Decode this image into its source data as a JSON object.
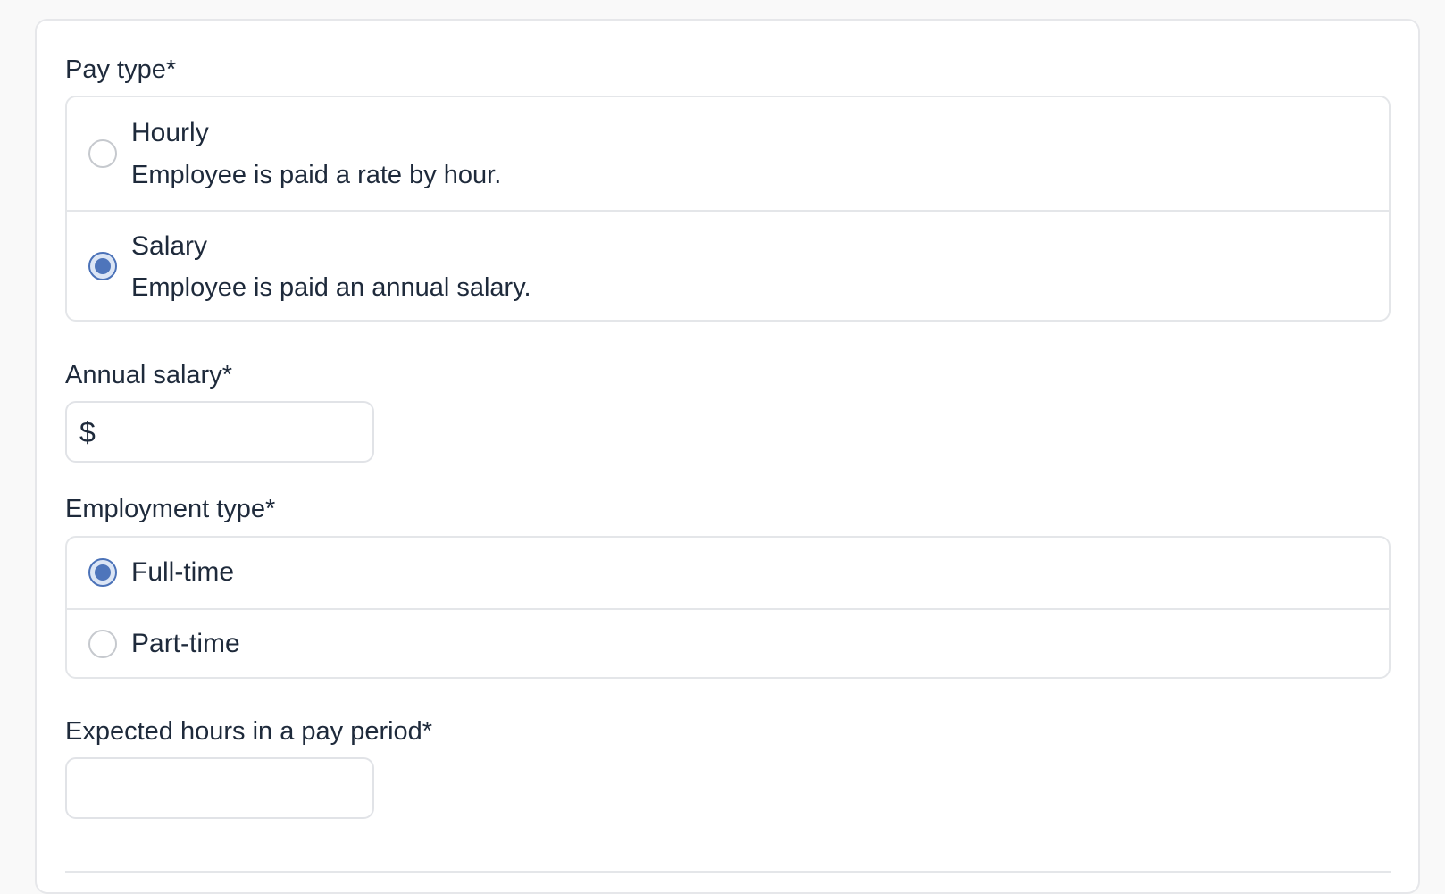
{
  "pay_type": {
    "label": "Pay type*",
    "options": [
      {
        "title": "Hourly",
        "description": "Employee is paid a rate by hour.",
        "checked": false
      },
      {
        "title": "Salary",
        "description": "Employee is paid an annual salary.",
        "checked": true
      }
    ]
  },
  "annual_salary": {
    "label": "Annual salary*",
    "prefix": "$",
    "value": "",
    "placeholder": ""
  },
  "employment_type": {
    "label": "Employment type*",
    "options": [
      {
        "title": "Full-time",
        "checked": true
      },
      {
        "title": "Part-time",
        "checked": false
      }
    ]
  },
  "expected_hours": {
    "label": "Expected hours in a pay period*",
    "value": "",
    "placeholder": ""
  },
  "colors": {
    "accent": "#4e75bb",
    "text": "#1e2a3b",
    "border": "#e4e6e9"
  }
}
